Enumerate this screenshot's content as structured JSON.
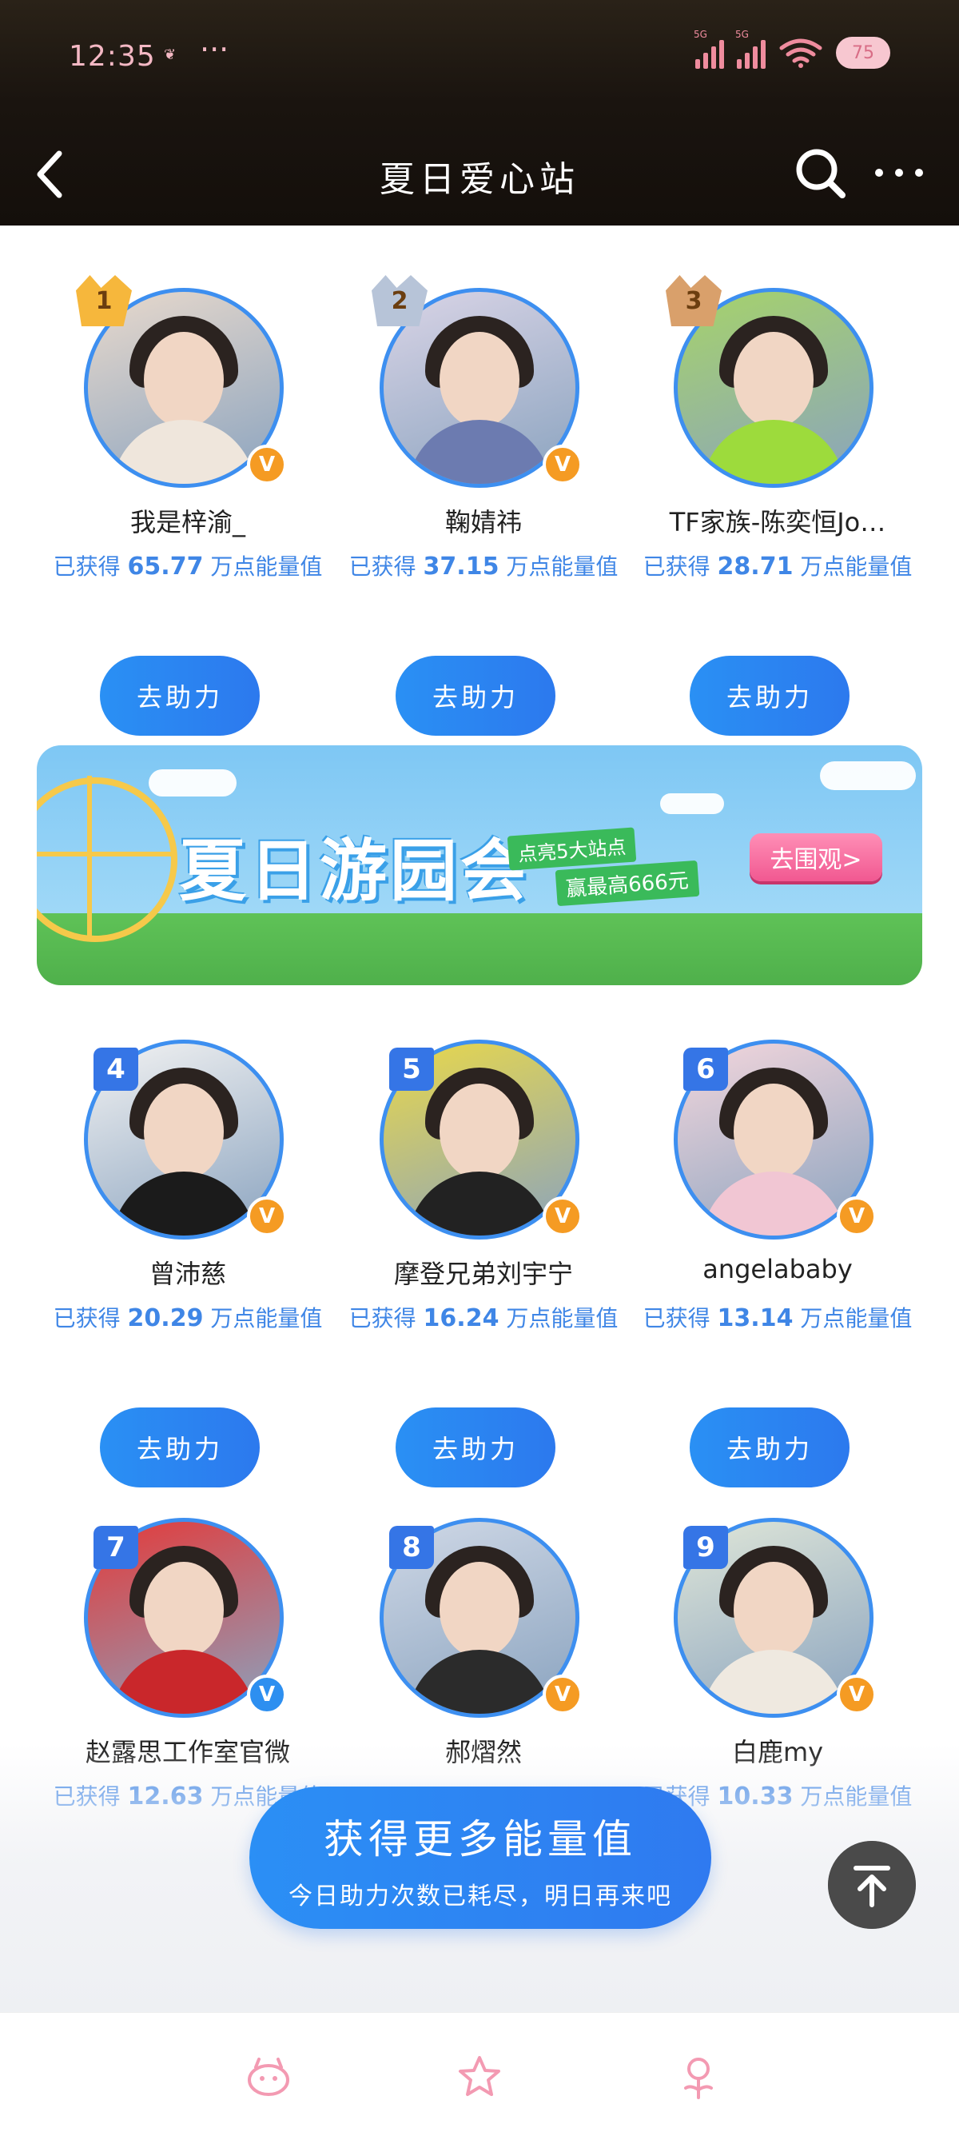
{
  "status_bar": {
    "time": "12:35",
    "dots": "···",
    "battery": "75",
    "net1": "5G",
    "net2": "5G"
  },
  "header": {
    "title": "夏日爱心站"
  },
  "energy_prefix": "已获得",
  "energy_suffix": "万点能量值",
  "help_label": "去助力",
  "ranking": [
    {
      "rank": "1",
      "name": "我是梓渝_",
      "energy": "65.77",
      "badge": "orange"
    },
    {
      "rank": "2",
      "name": "鞠婧祎",
      "energy": "37.15",
      "badge": "orange"
    },
    {
      "rank": "3",
      "name": "TF家族-陈奕恒Jo…",
      "energy": "28.71",
      "badge": ""
    },
    {
      "rank": "4",
      "name": "曾沛慈",
      "energy": "20.29",
      "badge": "orange"
    },
    {
      "rank": "5",
      "name": "摩登兄弟刘宇宁",
      "energy": "16.24",
      "badge": "orange"
    },
    {
      "rank": "6",
      "name": "angelababy",
      "energy": "13.14",
      "badge": "orange"
    },
    {
      "rank": "7",
      "name": "赵露思工作室官微",
      "energy": "12.63",
      "badge": "blue"
    },
    {
      "rank": "8",
      "name": "郝熠然",
      "energy": "",
      "badge": "orange"
    },
    {
      "rank": "9",
      "name": "白鹿my",
      "energy": "10.33",
      "badge": "orange"
    }
  ],
  "banner": {
    "title": "夏日游园会",
    "tag1": "点亮5大站点",
    "tag2": "赢最高666元",
    "button": "去围观>"
  },
  "cta": {
    "title": "获得更多能量值",
    "subtitle": "今日助力次数已耗尽，明日再来吧"
  },
  "colors": {
    "accent": "#2d86f2",
    "badge_orange": "#f59b23",
    "header_bg": "#1a140f"
  }
}
